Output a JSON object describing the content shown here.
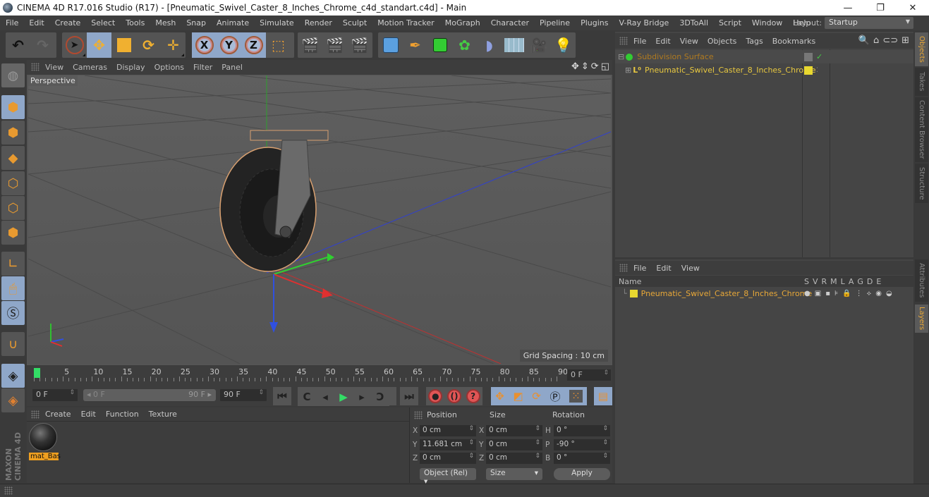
{
  "window": {
    "title": "CINEMA 4D R17.016 Studio (R17) - [Pneumatic_Swivel_Caster_8_Inches_Chrome_c4d_standart.c4d] - Main",
    "controls": {
      "minimize": "—",
      "restore": "❐",
      "close": "✕"
    }
  },
  "menubar": {
    "items": [
      "File",
      "Edit",
      "Create",
      "Select",
      "Tools",
      "Mesh",
      "Snap",
      "Animate",
      "Simulate",
      "Render",
      "Sculpt",
      "Motion Tracker",
      "MoGraph",
      "Character",
      "Pipeline",
      "Plugins",
      "V-Ray Bridge",
      "3DToAll",
      "Script",
      "Window",
      "Help"
    ],
    "layout_label": "Layout:",
    "layout_value": "Startup"
  },
  "toolbar": {
    "axis_labels": [
      "X",
      "Y",
      "Z"
    ]
  },
  "viewport": {
    "menu": [
      "View",
      "Cameras",
      "Display",
      "Options",
      "Filter",
      "Panel"
    ],
    "camera_label": "Perspective",
    "grid_spacing": "Grid Spacing : 10 cm",
    "nav_icons": [
      "✥",
      "⇕",
      "⟳",
      "◱"
    ]
  },
  "timeline": {
    "ticks": [
      "0",
      "5",
      "10",
      "15",
      "20",
      "25",
      "30",
      "35",
      "40",
      "45",
      "50",
      "55",
      "60",
      "65",
      "70",
      "75",
      "80",
      "85",
      "90"
    ],
    "current_frame": "0 F",
    "start_field": "0 F",
    "range_start": "0 F",
    "range_end": "90 F",
    "end_field": "90 F"
  },
  "materials": {
    "menu": [
      "Create",
      "Edit",
      "Function",
      "Texture"
    ],
    "items": [
      {
        "name": "mat_Bas"
      }
    ]
  },
  "coordinates": {
    "headers": {
      "position": "Position",
      "size": "Size",
      "rotation": "Rotation"
    },
    "position": {
      "x": "0 cm",
      "y": "11.681 cm",
      "z": "0 cm"
    },
    "size": {
      "x": "0 cm",
      "y": "0 cm",
      "z": "0 cm"
    },
    "rotation": {
      "h": "0 °",
      "p": "-90 °",
      "b": "0 °"
    },
    "axis_labels": {
      "x": "X",
      "y": "Y",
      "z": "Z",
      "h": "H",
      "p": "P",
      "b": "B"
    },
    "mode_dropdown": "Object (Rel)",
    "size_dropdown": "Size",
    "apply_label": "Apply"
  },
  "object_manager": {
    "menu": [
      "File",
      "Edit",
      "View",
      "Objects",
      "Tags",
      "Bookmarks"
    ],
    "objects": [
      {
        "name": "Subdivision Surface",
        "color": "#b07a20",
        "type": "subdivision"
      },
      {
        "name": "Pneumatic_Swivel_Caster_8_Inches_Chrome",
        "color": "#e8c840",
        "type": "null"
      }
    ]
  },
  "layer_manager": {
    "menu": [
      "File",
      "Edit",
      "View"
    ],
    "name_header": "Name",
    "columns": [
      "S",
      "V",
      "R",
      "M",
      "L",
      "A",
      "G",
      "D",
      "E"
    ],
    "layers": [
      {
        "name": "Pneumatic_Swivel_Caster_8_Inches_Chrome",
        "color": "#e8d830"
      }
    ]
  },
  "right_tabs": {
    "top": [
      "Objects",
      "Takes",
      "Content Browser",
      "Structure"
    ],
    "bottom": [
      "Attributes",
      "Layers"
    ]
  },
  "branding": "MAXON CINEMA 4D",
  "colors": {
    "accent": "#e8a838",
    "selected_blue": "#8fa7c9",
    "x_axis": "#e03030",
    "y_axis": "#30c030",
    "z_axis": "#3050e0"
  }
}
